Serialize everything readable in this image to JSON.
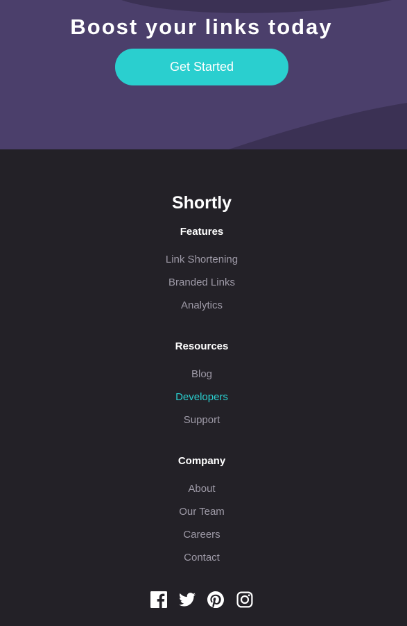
{
  "boost": {
    "title": "Boost your links today",
    "cta_label": "Get Started"
  },
  "footer": {
    "brand": "Shortly",
    "columns": [
      {
        "heading": "Features",
        "links": [
          "Link Shortening",
          "Branded Links",
          "Analytics"
        ]
      },
      {
        "heading": "Resources",
        "links": [
          "Blog",
          "Developers",
          "Support"
        ]
      },
      {
        "heading": "Company",
        "links": [
          "About",
          "Our Team",
          "Careers",
          "Contact"
        ]
      }
    ],
    "active_link": "Developers",
    "socials": [
      "facebook-icon",
      "twitter-icon",
      "pinterest-icon",
      "instagram-icon"
    ]
  },
  "colors": {
    "banner_bg": "#4b3f6b",
    "banner_shape": "#3a3054",
    "cta": "#2acfcf",
    "footer_bg": "#232127",
    "link": "#9e9aa7",
    "link_active": "#2acfcf",
    "heading": "#ffffff"
  }
}
